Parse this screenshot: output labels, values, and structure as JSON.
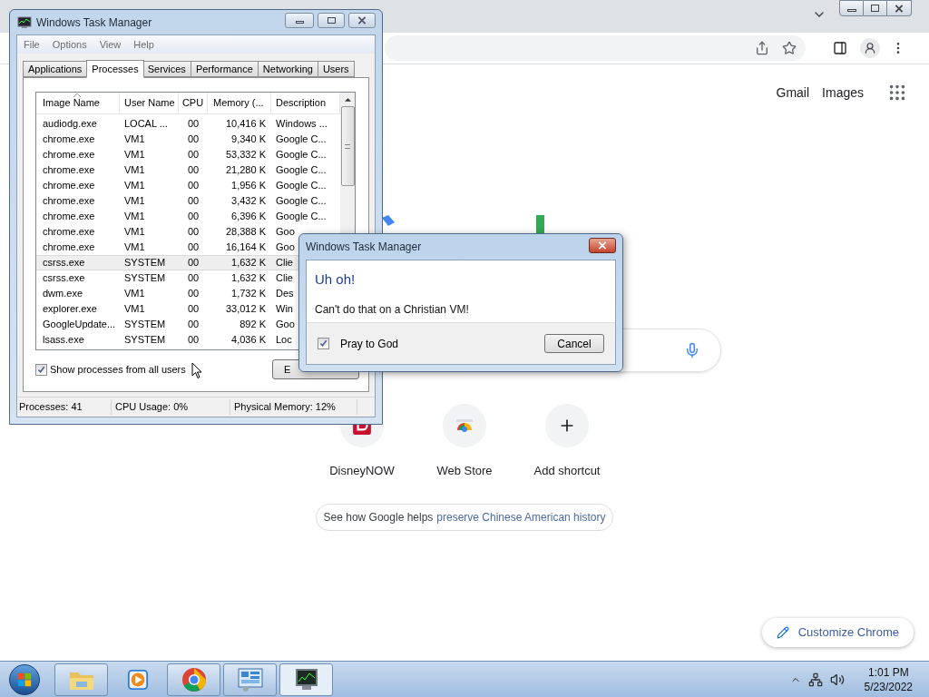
{
  "browser": {
    "top_links": [
      "Gmail",
      "Images"
    ],
    "shortcuts": [
      {
        "kind": "disney",
        "label": "DisneyNOW"
      },
      {
        "kind": "store",
        "label": "Web Store"
      },
      {
        "kind": "add",
        "label": "Add shortcut"
      }
    ],
    "promo": {
      "text": "See how Google helps",
      "link": "preserve Chinese American history"
    },
    "customize_button": "Customize Chrome"
  },
  "task_manager": {
    "title": "Windows Task Manager",
    "menu": [
      "File",
      "Options",
      "View",
      "Help"
    ],
    "tabs": [
      {
        "label": "Applications",
        "selected": false
      },
      {
        "label": "Processes",
        "selected": true
      },
      {
        "label": "Services",
        "selected": false
      },
      {
        "label": "Performance",
        "selected": false
      },
      {
        "label": "Networking",
        "selected": false
      },
      {
        "label": "Users",
        "selected": false
      }
    ],
    "columns": [
      "Image Name",
      "User Name",
      "CPU",
      "Memory (...",
      "Description"
    ],
    "rows": [
      {
        "cells": [
          "audiodg.exe",
          "LOCAL ...",
          "00",
          "10,416 K",
          "Windows ..."
        ],
        "selected": false
      },
      {
        "cells": [
          "chrome.exe",
          "VM1",
          "00",
          "9,340 K",
          "Google C..."
        ],
        "selected": false
      },
      {
        "cells": [
          "chrome.exe",
          "VM1",
          "00",
          "53,332 K",
          "Google C..."
        ],
        "selected": false
      },
      {
        "cells": [
          "chrome.exe",
          "VM1",
          "00",
          "21,280 K",
          "Google C..."
        ],
        "selected": false
      },
      {
        "cells": [
          "chrome.exe",
          "VM1",
          "00",
          "1,956 K",
          "Google C..."
        ],
        "selected": false
      },
      {
        "cells": [
          "chrome.exe",
          "VM1",
          "00",
          "3,432 K",
          "Google C..."
        ],
        "selected": false
      },
      {
        "cells": [
          "chrome.exe",
          "VM1",
          "00",
          "6,396 K",
          "Google C..."
        ],
        "selected": false
      },
      {
        "cells": [
          "chrome.exe",
          "VM1",
          "00",
          "28,388 K",
          "Goo"
        ],
        "selected": false
      },
      {
        "cells": [
          "chrome.exe",
          "VM1",
          "00",
          "16,164 K",
          "Goo"
        ],
        "selected": false
      },
      {
        "cells": [
          "csrss.exe",
          "SYSTEM",
          "00",
          "1,632 K",
          "Clie"
        ],
        "selected": true
      },
      {
        "cells": [
          "csrss.exe",
          "SYSTEM",
          "00",
          "1,632 K",
          "Clie"
        ],
        "selected": false
      },
      {
        "cells": [
          "dwm.exe",
          "VM1",
          "00",
          "1,732 K",
          "Des"
        ],
        "selected": false
      },
      {
        "cells": [
          "explorer.exe",
          "VM1",
          "00",
          "33,012 K",
          "Win"
        ],
        "selected": false
      },
      {
        "cells": [
          "GoogleUpdate...",
          "SYSTEM",
          "00",
          "892 K",
          "Goo"
        ],
        "selected": false
      },
      {
        "cells": [
          "lsass.exe",
          "SYSTEM",
          "00",
          "4,036 K",
          "Loc"
        ],
        "selected": false
      }
    ],
    "show_all_users": {
      "label": "Show processes from all users",
      "checked": true
    },
    "end_button": "E",
    "status": [
      "Processes: 41",
      "CPU Usage: 0%",
      "Physical Memory: 12%"
    ]
  },
  "dialog": {
    "title": "Windows Task Manager",
    "heading": "Uh oh!",
    "message": "Can't do that on a Christian VM!",
    "checkbox": {
      "label": "Pray to God",
      "checked": true
    },
    "button": "Cancel"
  },
  "taskbar": {
    "items": [
      {
        "kind": "folder",
        "running": true,
        "selected": false
      },
      {
        "kind": "media",
        "running": false,
        "selected": false
      },
      {
        "kind": "chrome",
        "running": true,
        "selected": false
      },
      {
        "kind": "panel",
        "running": true,
        "selected": false
      },
      {
        "kind": "monitor",
        "running": true,
        "selected": true
      }
    ],
    "time": "1:01 PM",
    "date": "5/23/2022"
  }
}
